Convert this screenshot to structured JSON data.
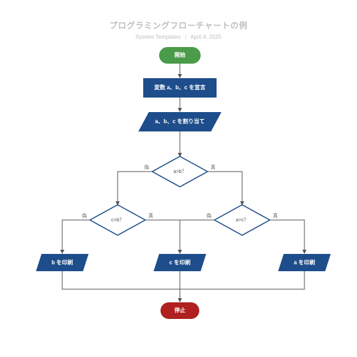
{
  "header": {
    "title": "プログラミングフローチャートの例",
    "author": "System Templates",
    "date": "April 4, 2025"
  },
  "nodes": {
    "start": "開始",
    "declare": "変数 a、b、c を宣言",
    "assign": "a、b、c を割り当て",
    "d1": "a>b？",
    "d2": "c>b？",
    "d3": "a>c？",
    "p_b": "b を印刷",
    "p_c": "c を印刷",
    "p_a": "a を印刷",
    "stop": "停止"
  },
  "labels": {
    "yes": "真",
    "no": "偽"
  }
}
